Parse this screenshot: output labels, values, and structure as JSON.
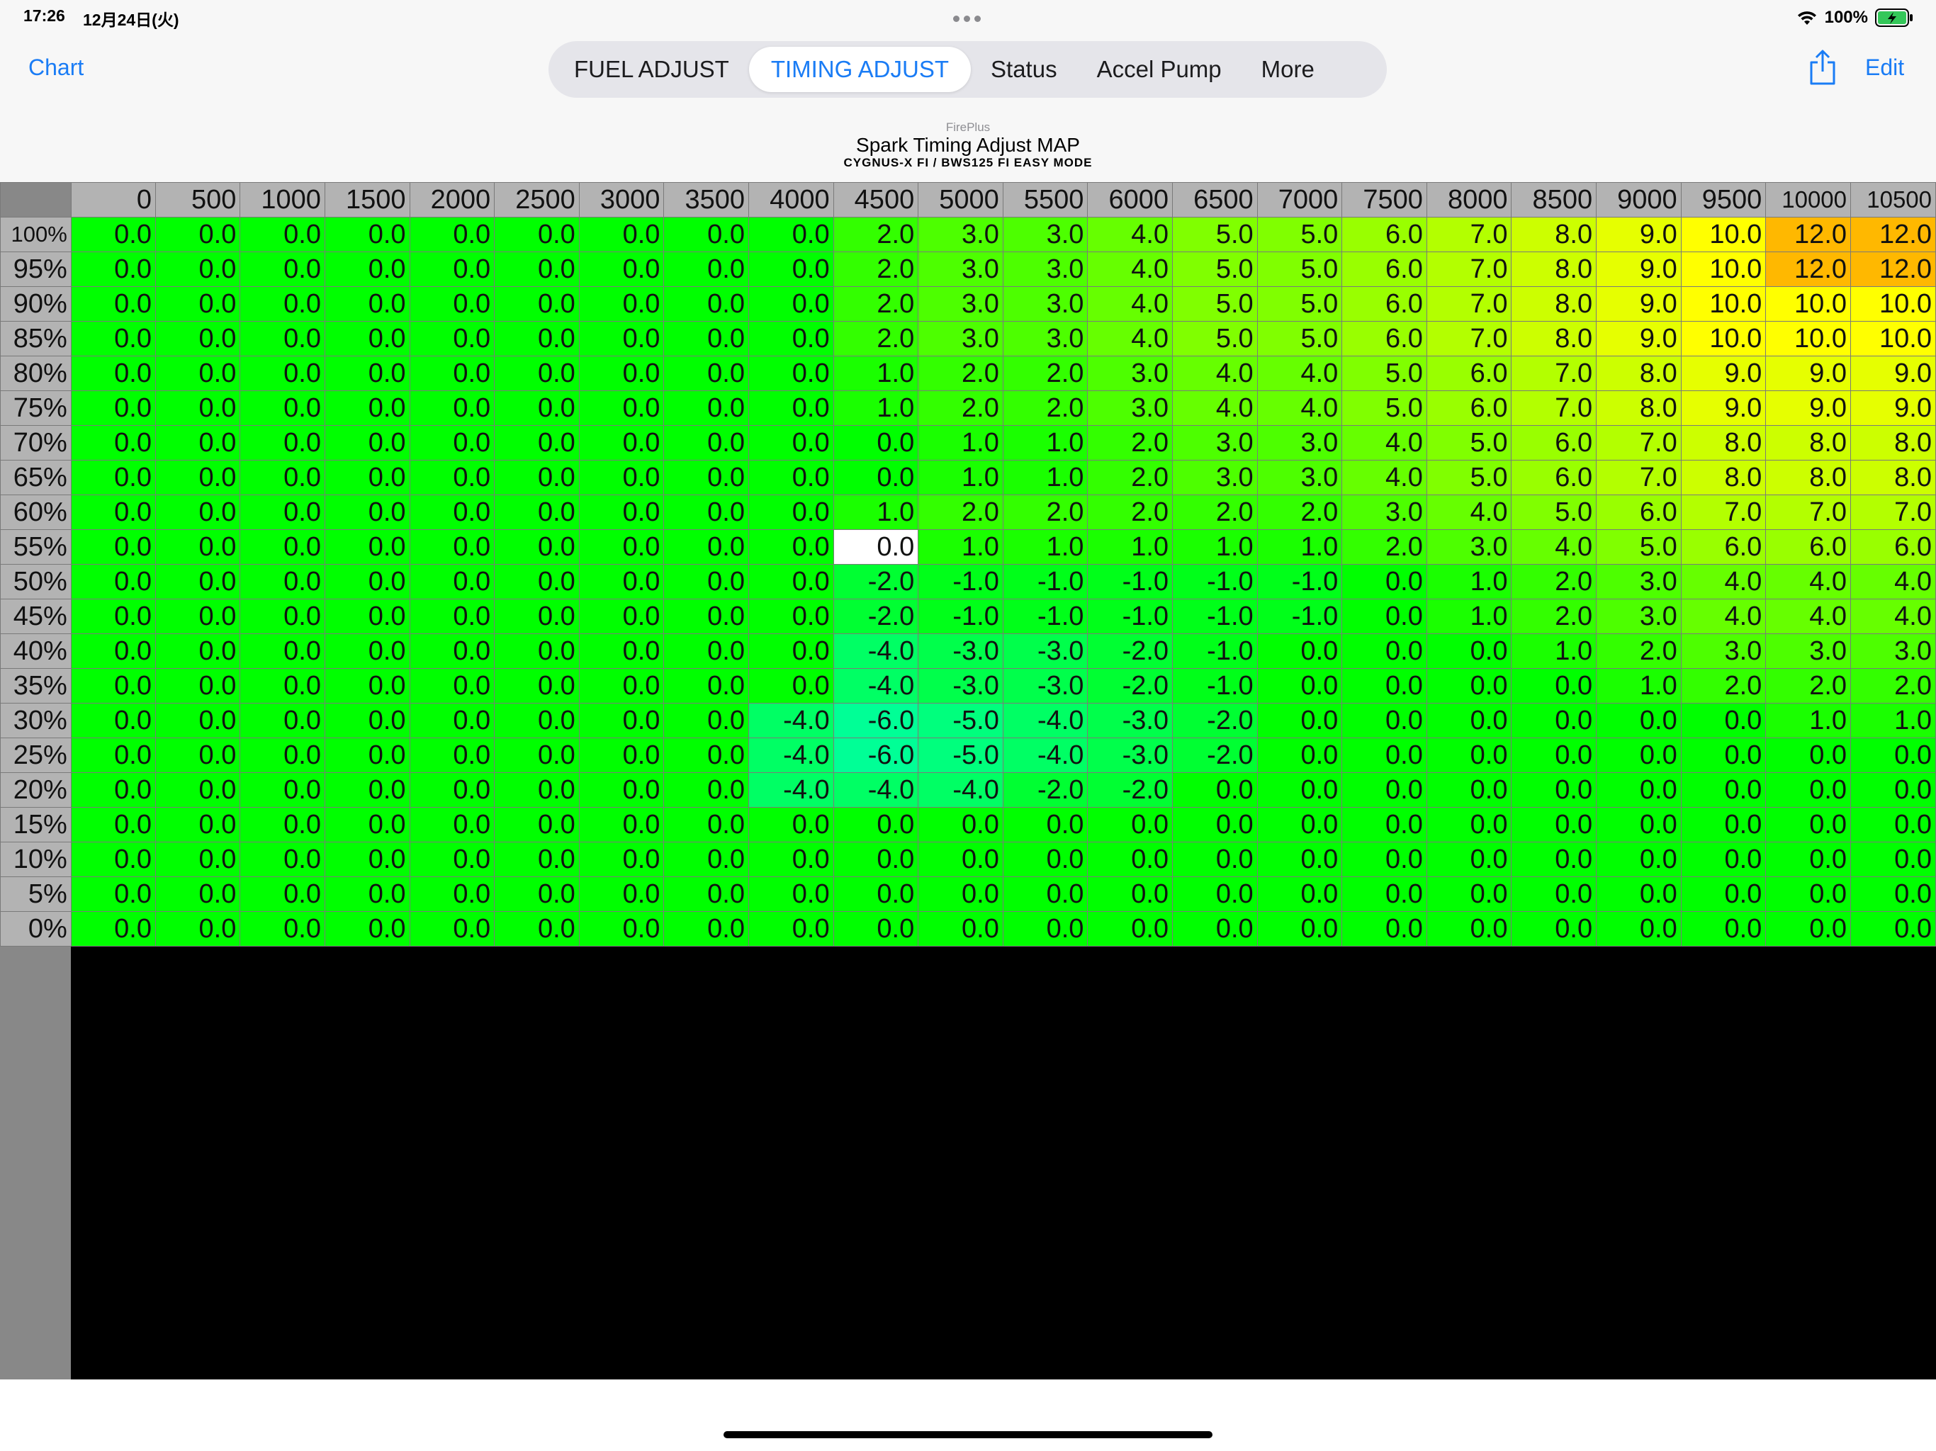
{
  "status_bar": {
    "time": "17:26",
    "date": "12月24日(火)",
    "battery": "100%",
    "wifi_icon": "wifi-icon",
    "battery_icon": "battery-charging-icon"
  },
  "nav": {
    "left_label": "Chart",
    "tabs": [
      {
        "label": "FUEL ADJUST",
        "active": false
      },
      {
        "label": "TIMING ADJUST",
        "active": true
      },
      {
        "label": "Status",
        "active": false
      },
      {
        "label": "Accel Pump",
        "active": false
      },
      {
        "label": "More",
        "active": false
      }
    ],
    "share_icon": "share-icon",
    "right_label": "Edit"
  },
  "title": {
    "brand": "FirePlus",
    "main": "Spark Timing Adjust MAP",
    "sub": "CYGNUS-X FI / BWS125 FI EASY MODE"
  },
  "map": {
    "columns": [
      "0",
      "500",
      "1000",
      "1500",
      "2000",
      "2500",
      "3000",
      "3500",
      "4000",
      "4500",
      "5000",
      "5500",
      "6000",
      "6500",
      "7000",
      "7500",
      "8000",
      "8500",
      "9000",
      "9500",
      "10000",
      "10500"
    ],
    "rows": [
      {
        "label": "100%",
        "values": [
          "0.0",
          "0.0",
          "0.0",
          "0.0",
          "0.0",
          "0.0",
          "0.0",
          "0.0",
          "0.0",
          "2.0",
          "3.0",
          "3.0",
          "4.0",
          "5.0",
          "5.0",
          "6.0",
          "7.0",
          "8.0",
          "9.0",
          "10.0",
          "12.0",
          "12.0"
        ]
      },
      {
        "label": "95%",
        "values": [
          "0.0",
          "0.0",
          "0.0",
          "0.0",
          "0.0",
          "0.0",
          "0.0",
          "0.0",
          "0.0",
          "2.0",
          "3.0",
          "3.0",
          "4.0",
          "5.0",
          "5.0",
          "6.0",
          "7.0",
          "8.0",
          "9.0",
          "10.0",
          "12.0",
          "12.0"
        ]
      },
      {
        "label": "90%",
        "values": [
          "0.0",
          "0.0",
          "0.0",
          "0.0",
          "0.0",
          "0.0",
          "0.0",
          "0.0",
          "0.0",
          "2.0",
          "3.0",
          "3.0",
          "4.0",
          "5.0",
          "5.0",
          "6.0",
          "7.0",
          "8.0",
          "9.0",
          "10.0",
          "10.0",
          "10.0"
        ]
      },
      {
        "label": "85%",
        "values": [
          "0.0",
          "0.0",
          "0.0",
          "0.0",
          "0.0",
          "0.0",
          "0.0",
          "0.0",
          "0.0",
          "2.0",
          "3.0",
          "3.0",
          "4.0",
          "5.0",
          "5.0",
          "6.0",
          "7.0",
          "8.0",
          "9.0",
          "10.0",
          "10.0",
          "10.0"
        ]
      },
      {
        "label": "80%",
        "values": [
          "0.0",
          "0.0",
          "0.0",
          "0.0",
          "0.0",
          "0.0",
          "0.0",
          "0.0",
          "0.0",
          "1.0",
          "2.0",
          "2.0",
          "3.0",
          "4.0",
          "4.0",
          "5.0",
          "6.0",
          "7.0",
          "8.0",
          "9.0",
          "9.0",
          "9.0"
        ]
      },
      {
        "label": "75%",
        "values": [
          "0.0",
          "0.0",
          "0.0",
          "0.0",
          "0.0",
          "0.0",
          "0.0",
          "0.0",
          "0.0",
          "1.0",
          "2.0",
          "2.0",
          "3.0",
          "4.0",
          "4.0",
          "5.0",
          "6.0",
          "7.0",
          "8.0",
          "9.0",
          "9.0",
          "9.0"
        ]
      },
      {
        "label": "70%",
        "values": [
          "0.0",
          "0.0",
          "0.0",
          "0.0",
          "0.0",
          "0.0",
          "0.0",
          "0.0",
          "0.0",
          "0.0",
          "1.0",
          "1.0",
          "2.0",
          "3.0",
          "3.0",
          "4.0",
          "5.0",
          "6.0",
          "7.0",
          "8.0",
          "8.0",
          "8.0"
        ]
      },
      {
        "label": "65%",
        "values": [
          "0.0",
          "0.0",
          "0.0",
          "0.0",
          "0.0",
          "0.0",
          "0.0",
          "0.0",
          "0.0",
          "0.0",
          "1.0",
          "1.0",
          "2.0",
          "3.0",
          "3.0",
          "4.0",
          "5.0",
          "6.0",
          "7.0",
          "8.0",
          "8.0",
          "8.0"
        ]
      },
      {
        "label": "60%",
        "values": [
          "0.0",
          "0.0",
          "0.0",
          "0.0",
          "0.0",
          "0.0",
          "0.0",
          "0.0",
          "0.0",
          "1.0",
          "2.0",
          "2.0",
          "2.0",
          "2.0",
          "2.0",
          "3.0",
          "4.0",
          "5.0",
          "6.0",
          "7.0",
          "7.0",
          "7.0"
        ]
      },
      {
        "label": "55%",
        "values": [
          "0.0",
          "0.0",
          "0.0",
          "0.0",
          "0.0",
          "0.0",
          "0.0",
          "0.0",
          "0.0",
          "0.0",
          "1.0",
          "1.0",
          "1.0",
          "1.0",
          "1.0",
          "2.0",
          "3.0",
          "4.0",
          "5.0",
          "6.0",
          "6.0",
          "6.0"
        ]
      },
      {
        "label": "50%",
        "values": [
          "0.0",
          "0.0",
          "0.0",
          "0.0",
          "0.0",
          "0.0",
          "0.0",
          "0.0",
          "0.0",
          "-2.0",
          "-1.0",
          "-1.0",
          "-1.0",
          "-1.0",
          "-1.0",
          "0.0",
          "1.0",
          "2.0",
          "3.0",
          "4.0",
          "4.0",
          "4.0"
        ]
      },
      {
        "label": "45%",
        "values": [
          "0.0",
          "0.0",
          "0.0",
          "0.0",
          "0.0",
          "0.0",
          "0.0",
          "0.0",
          "0.0",
          "-2.0",
          "-1.0",
          "-1.0",
          "-1.0",
          "-1.0",
          "-1.0",
          "0.0",
          "1.0",
          "2.0",
          "3.0",
          "4.0",
          "4.0",
          "4.0"
        ]
      },
      {
        "label": "40%",
        "values": [
          "0.0",
          "0.0",
          "0.0",
          "0.0",
          "0.0",
          "0.0",
          "0.0",
          "0.0",
          "0.0",
          "-4.0",
          "-3.0",
          "-3.0",
          "-2.0",
          "-1.0",
          "0.0",
          "0.0",
          "0.0",
          "1.0",
          "2.0",
          "3.0",
          "3.0",
          "3.0"
        ]
      },
      {
        "label": "35%",
        "values": [
          "0.0",
          "0.0",
          "0.0",
          "0.0",
          "0.0",
          "0.0",
          "0.0",
          "0.0",
          "0.0",
          "-4.0",
          "-3.0",
          "-3.0",
          "-2.0",
          "-1.0",
          "0.0",
          "0.0",
          "0.0",
          "0.0",
          "1.0",
          "2.0",
          "2.0",
          "2.0"
        ]
      },
      {
        "label": "30%",
        "values": [
          "0.0",
          "0.0",
          "0.0",
          "0.0",
          "0.0",
          "0.0",
          "0.0",
          "0.0",
          "-4.0",
          "-6.0",
          "-5.0",
          "-4.0",
          "-3.0",
          "-2.0",
          "0.0",
          "0.0",
          "0.0",
          "0.0",
          "0.0",
          "0.0",
          "1.0",
          "1.0"
        ]
      },
      {
        "label": "25%",
        "values": [
          "0.0",
          "0.0",
          "0.0",
          "0.0",
          "0.0",
          "0.0",
          "0.0",
          "0.0",
          "-4.0",
          "-6.0",
          "-5.0",
          "-4.0",
          "-3.0",
          "-2.0",
          "0.0",
          "0.0",
          "0.0",
          "0.0",
          "0.0",
          "0.0",
          "0.0",
          "0.0"
        ]
      },
      {
        "label": "20%",
        "values": [
          "0.0",
          "0.0",
          "0.0",
          "0.0",
          "0.0",
          "0.0",
          "0.0",
          "0.0",
          "-4.0",
          "-4.0",
          "-4.0",
          "-2.0",
          "-2.0",
          "0.0",
          "0.0",
          "0.0",
          "0.0",
          "0.0",
          "0.0",
          "0.0",
          "0.0",
          "0.0"
        ]
      },
      {
        "label": "15%",
        "values": [
          "0.0",
          "0.0",
          "0.0",
          "0.0",
          "0.0",
          "0.0",
          "0.0",
          "0.0",
          "0.0",
          "0.0",
          "0.0",
          "0.0",
          "0.0",
          "0.0",
          "0.0",
          "0.0",
          "0.0",
          "0.0",
          "0.0",
          "0.0",
          "0.0",
          "0.0"
        ]
      },
      {
        "label": "10%",
        "values": [
          "0.0",
          "0.0",
          "0.0",
          "0.0",
          "0.0",
          "0.0",
          "0.0",
          "0.0",
          "0.0",
          "0.0",
          "0.0",
          "0.0",
          "0.0",
          "0.0",
          "0.0",
          "0.0",
          "0.0",
          "0.0",
          "0.0",
          "0.0",
          "0.0",
          "0.0"
        ]
      },
      {
        "label": "5%",
        "values": [
          "0.0",
          "0.0",
          "0.0",
          "0.0",
          "0.0",
          "0.0",
          "0.0",
          "0.0",
          "0.0",
          "0.0",
          "0.0",
          "0.0",
          "0.0",
          "0.0",
          "0.0",
          "0.0",
          "0.0",
          "0.0",
          "0.0",
          "0.0",
          "0.0",
          "0.0"
        ]
      },
      {
        "label": "0%",
        "values": [
          "0.0",
          "0.0",
          "0.0",
          "0.0",
          "0.0",
          "0.0",
          "0.0",
          "0.0",
          "0.0",
          "0.0",
          "0.0",
          "0.0",
          "0.0",
          "0.0",
          "0.0",
          "0.0",
          "0.0",
          "0.0",
          "0.0",
          "0.0",
          "0.0",
          "0.0"
        ]
      }
    ],
    "selected_cell": {
      "row": 9,
      "col": 9
    },
    "colors": {
      "zero": "#00ff00",
      "selected": "#ffffff",
      "header_bg": "#b3b3b3",
      "accent": "#1a7cf5"
    }
  }
}
